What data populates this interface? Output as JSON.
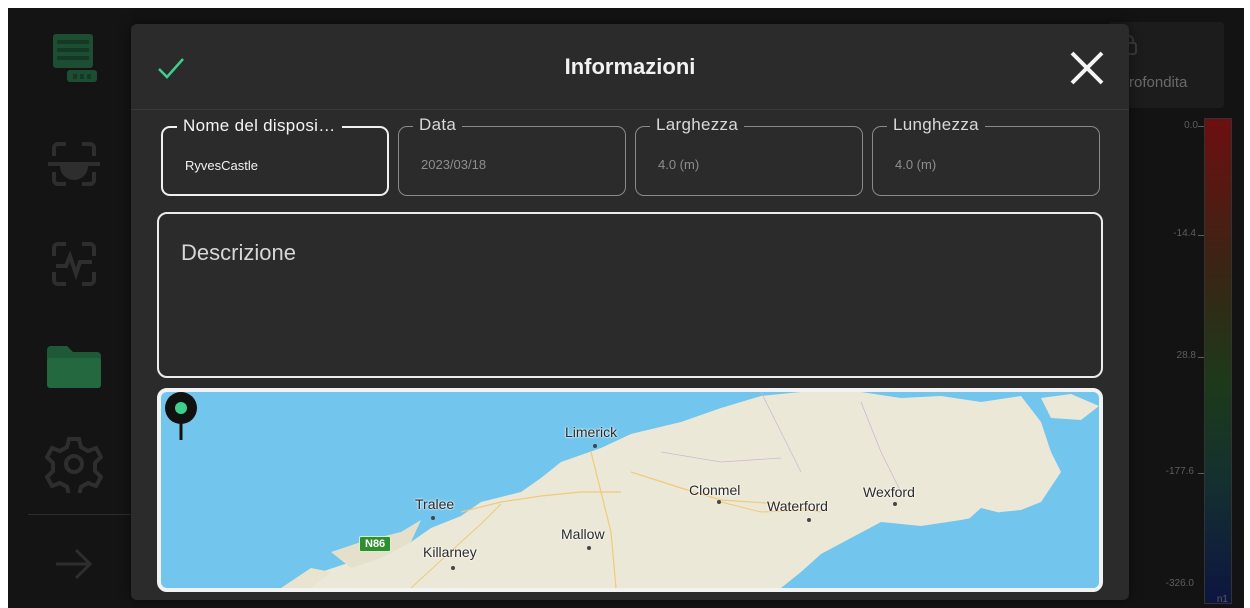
{
  "dialog": {
    "title": "Informazioni",
    "confirm_icon": "check-icon",
    "close_icon": "close-icon"
  },
  "fields": [
    {
      "label": "Nome del disposi…",
      "value": "RyvesCastle",
      "active": true
    },
    {
      "label": "Data",
      "value": "2023/03/18",
      "active": false
    },
    {
      "label": "Larghezza",
      "value": "4.0 (m)",
      "active": false
    },
    {
      "label": "Lunghezza",
      "value": "4.0 (m)",
      "active": false
    }
  ],
  "description": {
    "placeholder": "Descrizione"
  },
  "map": {
    "places": [
      "Limerick",
      "Tralee",
      "Clonmel",
      "Waterford",
      "Wexford",
      "Mallow",
      "Killarney"
    ],
    "road_badge": "N86",
    "pin_color": "#3ecf8e"
  },
  "background": {
    "tab_label": "rofondita",
    "scale_ticks": [
      "0.0",
      "-14.4",
      "28.8",
      "-177.6",
      "-326.0"
    ],
    "scale_unit": "n1"
  },
  "colors": {
    "accent_check": "#3ecf8e",
    "sidebar_icon": "#1f5a38",
    "dialog_bg": "#2b2b2b"
  }
}
